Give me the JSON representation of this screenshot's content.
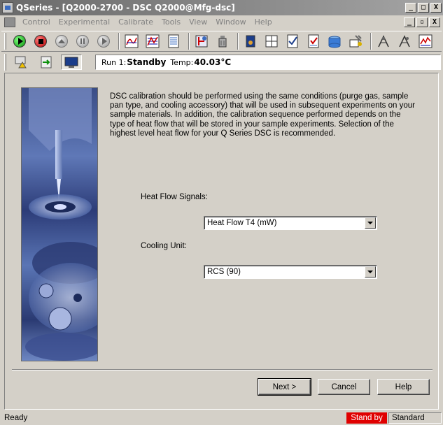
{
  "window": {
    "title": "QSeries - [Q2000-2700 - DSC Q2000@Mfg-dsc]",
    "minimize": "_",
    "restore": "□",
    "close": "X"
  },
  "menu": {
    "items": [
      "Control",
      "Experimental",
      "Calibrate",
      "Tools",
      "View",
      "Window",
      "Help"
    ],
    "doc_restore": "🗗",
    "doc_close": "X"
  },
  "toolbar": {
    "icons": [
      "start-icon",
      "stop-icon",
      "eject-icon",
      "pause-icon",
      "skip-icon",
      "thermal-curve-icon",
      "signal-plot-icon",
      "notes-icon",
      "method-icon",
      "autosampler-icon",
      "furnace-icon",
      "grid-icon",
      "checklist-icon",
      "calibration-icon",
      "cooling-unit-icon",
      "tools-icon",
      "peak-icon",
      "peak2-icon",
      "chart-icon"
    ]
  },
  "run_status": {
    "run_label": "Run 1:",
    "run_state": "Standby",
    "temp_label": "Temp:",
    "temp_value": "40.03°C"
  },
  "wizard": {
    "description": "DSC calibration should be performed using the same conditions (purge gas, sample pan type, and cooling accessory) that will be used in subsequent experiments on your sample materials. In addition, the calibration sequence performed depends on the type of heat flow that will be stored in your sample experiments.  Selection of the highest level heat flow for your Q Series DSC is recommended.",
    "heat_flow_label": "Heat Flow Signals:",
    "heat_flow_value": "Heat Flow T4 (mW)",
    "cooling_label": "Cooling Unit:",
    "cooling_value": "RCS (90)",
    "next_button": "Next >",
    "cancel_button": "Cancel",
    "help_button": "Help"
  },
  "statusbar": {
    "ready": "Ready",
    "state": "Stand by",
    "mode": "Standard"
  },
  "colors": {
    "title_bar": "#7a7a7a",
    "status_red": "#e00000",
    "image_blue": "#3a4d86"
  }
}
